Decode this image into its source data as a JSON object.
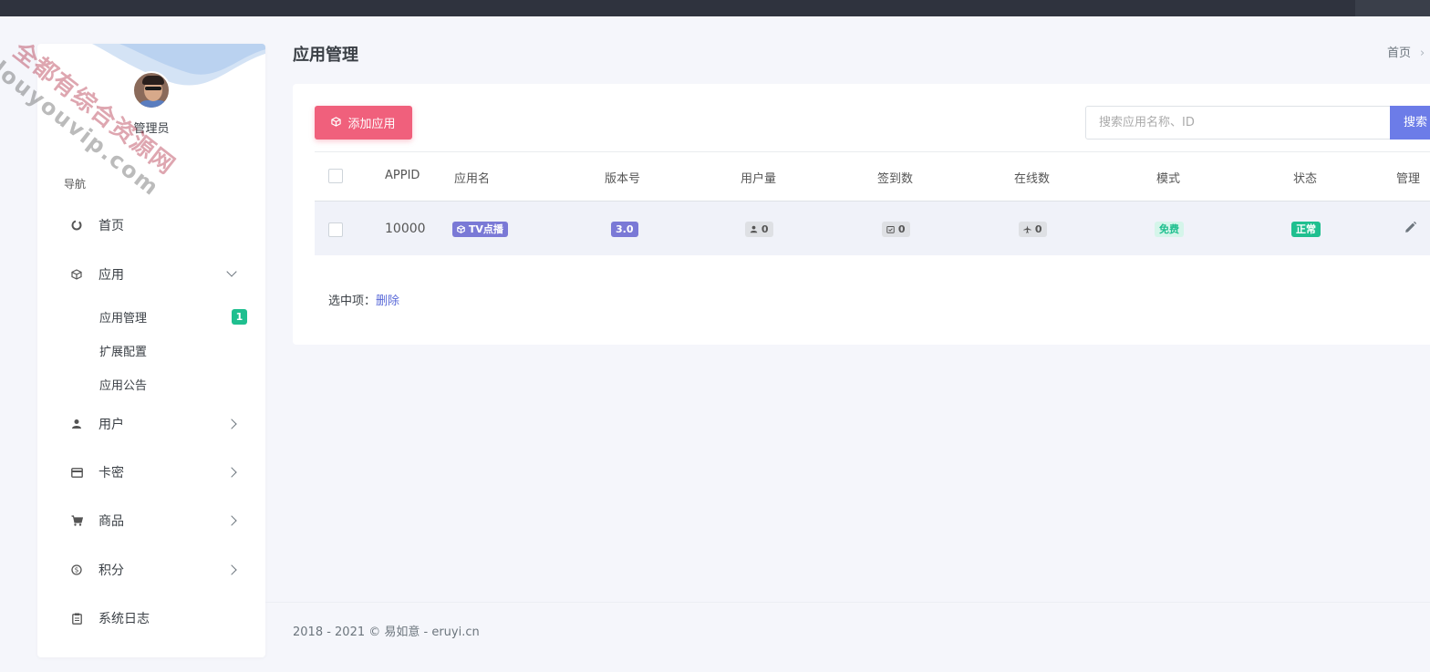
{
  "colors": {
    "accent": "#6c7ce8",
    "add_button": "#f0607c",
    "green": "#1fbf8f",
    "tag_purple": "#7a79d6",
    "topbar": "#2f333e"
  },
  "watermark": {
    "line1": "全都有综合资源网",
    "line2": "douyouvip.com"
  },
  "user": {
    "name": "管理员",
    "avatar_icon": "user-avatar"
  },
  "sidebar": {
    "heading": "导航",
    "items": [
      {
        "label": "首页",
        "icon": "dashboard-icon"
      },
      {
        "label": "应用",
        "icon": "cube-icon",
        "expanded": true,
        "children": [
          {
            "label": "应用管理",
            "badge": "1"
          },
          {
            "label": "扩展配置"
          },
          {
            "label": "应用公告"
          }
        ]
      },
      {
        "label": "用户",
        "icon": "user-icon"
      },
      {
        "label": "卡密",
        "icon": "card-icon"
      },
      {
        "label": "商品",
        "icon": "cart-icon"
      },
      {
        "label": "积分",
        "icon": "coin-icon"
      },
      {
        "label": "系统日志",
        "icon": "clipboard-icon"
      }
    ]
  },
  "page": {
    "title": "应用管理",
    "breadcrumb": "首页"
  },
  "toolbar": {
    "add_label": "添加应用",
    "search_placeholder": "搜索应用名称、ID",
    "search_label": "搜索"
  },
  "table": {
    "headers": [
      "APPID",
      "应用名",
      "版本号",
      "用户量",
      "签到数",
      "在线数",
      "模式",
      "状态",
      "管理"
    ],
    "rows": [
      {
        "appid": "10000",
        "name": "TV点播",
        "version": "3.0",
        "users": "0",
        "checkins": "0",
        "online": "0",
        "mode": "免费",
        "status": "正常"
      }
    ]
  },
  "selected_ops": {
    "label": "选中项：",
    "delete": "删除"
  },
  "footer": "2018 - 2021 © 易如意 - eruyi.cn"
}
